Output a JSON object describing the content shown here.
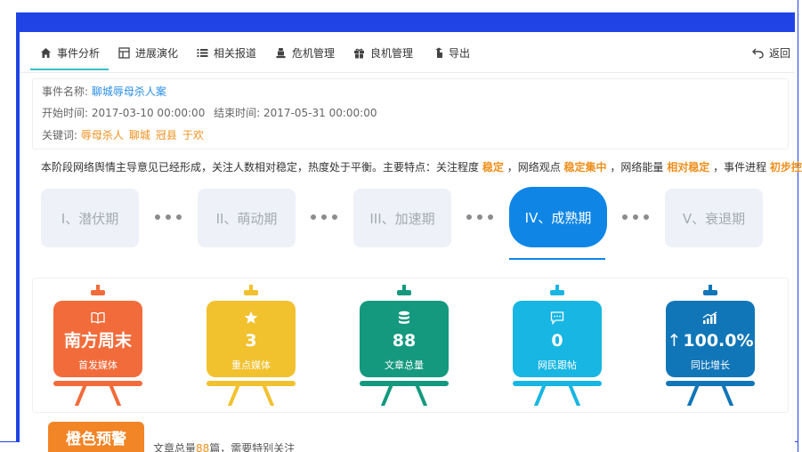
{
  "tabs": [
    {
      "label": "事件分析",
      "icon": "home-icon"
    },
    {
      "label": "进展演化",
      "icon": "timeline-icon"
    },
    {
      "label": "相关报道",
      "icon": "list-icon"
    },
    {
      "label": "危机管理",
      "icon": "alarm-icon"
    },
    {
      "label": "良机管理",
      "icon": "gift-icon"
    },
    {
      "label": "导出",
      "icon": "export-icon"
    }
  ],
  "back_label": "返回",
  "info": {
    "name_label": "事件名称:",
    "name_value": "聊城辱母杀人案",
    "start_label": "开始时间:",
    "start_value": "2017-03-10 00:00:00",
    "end_label": "结束时间:",
    "end_value": "2017-05-31 00:00:00",
    "keywords_label": "关键词:",
    "keywords": [
      "辱母杀人",
      "聊城",
      "冠县",
      "于欢"
    ]
  },
  "summary": {
    "intro": "本阶段网络舆情主导意见已经形成，关注人数相对稳定，热度处于平衡。主要特点：关注程度",
    "attention": "稳定",
    "sep1": "，网络观点",
    "opinion": "稳定集中",
    "sep2": "，网络能量",
    "energy": "相对稳定",
    "sep3": "，事件进程",
    "process": "初步控制"
  },
  "stages": [
    "I、潜伏期",
    "II、萌动期",
    "III、加速期",
    "IV、成熟期",
    "V、衰退期"
  ],
  "active_stage": "IV、成熟期",
  "stats": [
    {
      "value": "南方周末",
      "label": "首发媒体",
      "color": "#f26b3a",
      "icon": "book-icon"
    },
    {
      "value": "3",
      "label": "重点媒体",
      "color": "#f2c12e",
      "icon": "star-icon"
    },
    {
      "value": "88",
      "label": "文章总量",
      "color": "#14997f",
      "icon": "database-icon"
    },
    {
      "value": "0",
      "label": "网民跟帖",
      "color": "#17b6e3",
      "icon": "comment-icon"
    },
    {
      "value": "100.0%",
      "label": "同比增长",
      "color": "#1176b8",
      "icon": "chart-icon"
    }
  ],
  "warning": {
    "label": "橙色预警",
    "text_before": "文章总量",
    "count": "88",
    "text_after": "篇，需要特别关注"
  },
  "colors": {
    "frame": "#1f43e5",
    "active_tab_line": "#38c0c6",
    "active_stage": "#0f86e6",
    "highlight": "#ef8f1c",
    "link": "#2a8ee8"
  }
}
